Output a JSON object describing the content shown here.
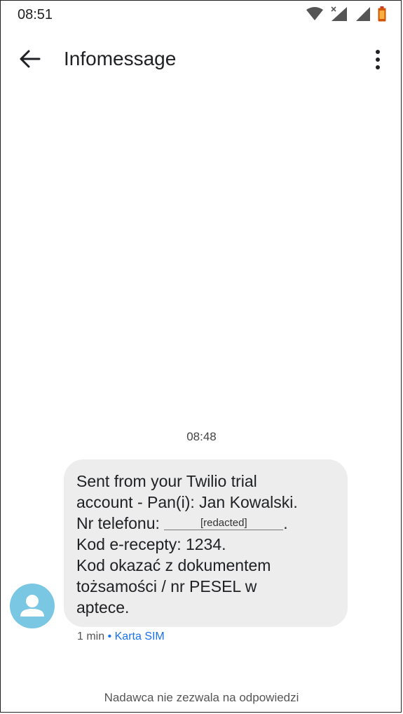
{
  "status_bar": {
    "time": "08:51",
    "icons": [
      "wifi-icon",
      "signal-x-icon",
      "signal-icon",
      "battery-icon"
    ]
  },
  "app_bar": {
    "title": "Infomessage",
    "back_icon": "arrow-back-icon",
    "menu_icon": "more-vert-icon"
  },
  "conversation": {
    "timestamp": "08:48",
    "message": {
      "line1": "Sent from your Twilio trial",
      "line2": "account - Pan(i):  Jan Kowalski.",
      "line3_prefix": "Nr telefonu: ",
      "redacted": "[redacted]",
      "line3_suffix": ".",
      "line4": "Kod e-recepty:  1234.",
      "line5": "Kod okazać z dokumentem",
      "line6": "tożsamości / nr PESEL w",
      "line7": "aptece."
    },
    "meta_time": "1 min",
    "meta_separator": " • ",
    "meta_sim": "Karta SIM"
  },
  "footer": {
    "notice": "Nadawca nie zezwala na odpowiedzi"
  },
  "colors": {
    "avatar": "#79c7e3",
    "bubble": "#ededed",
    "link": "#1a73e8"
  }
}
